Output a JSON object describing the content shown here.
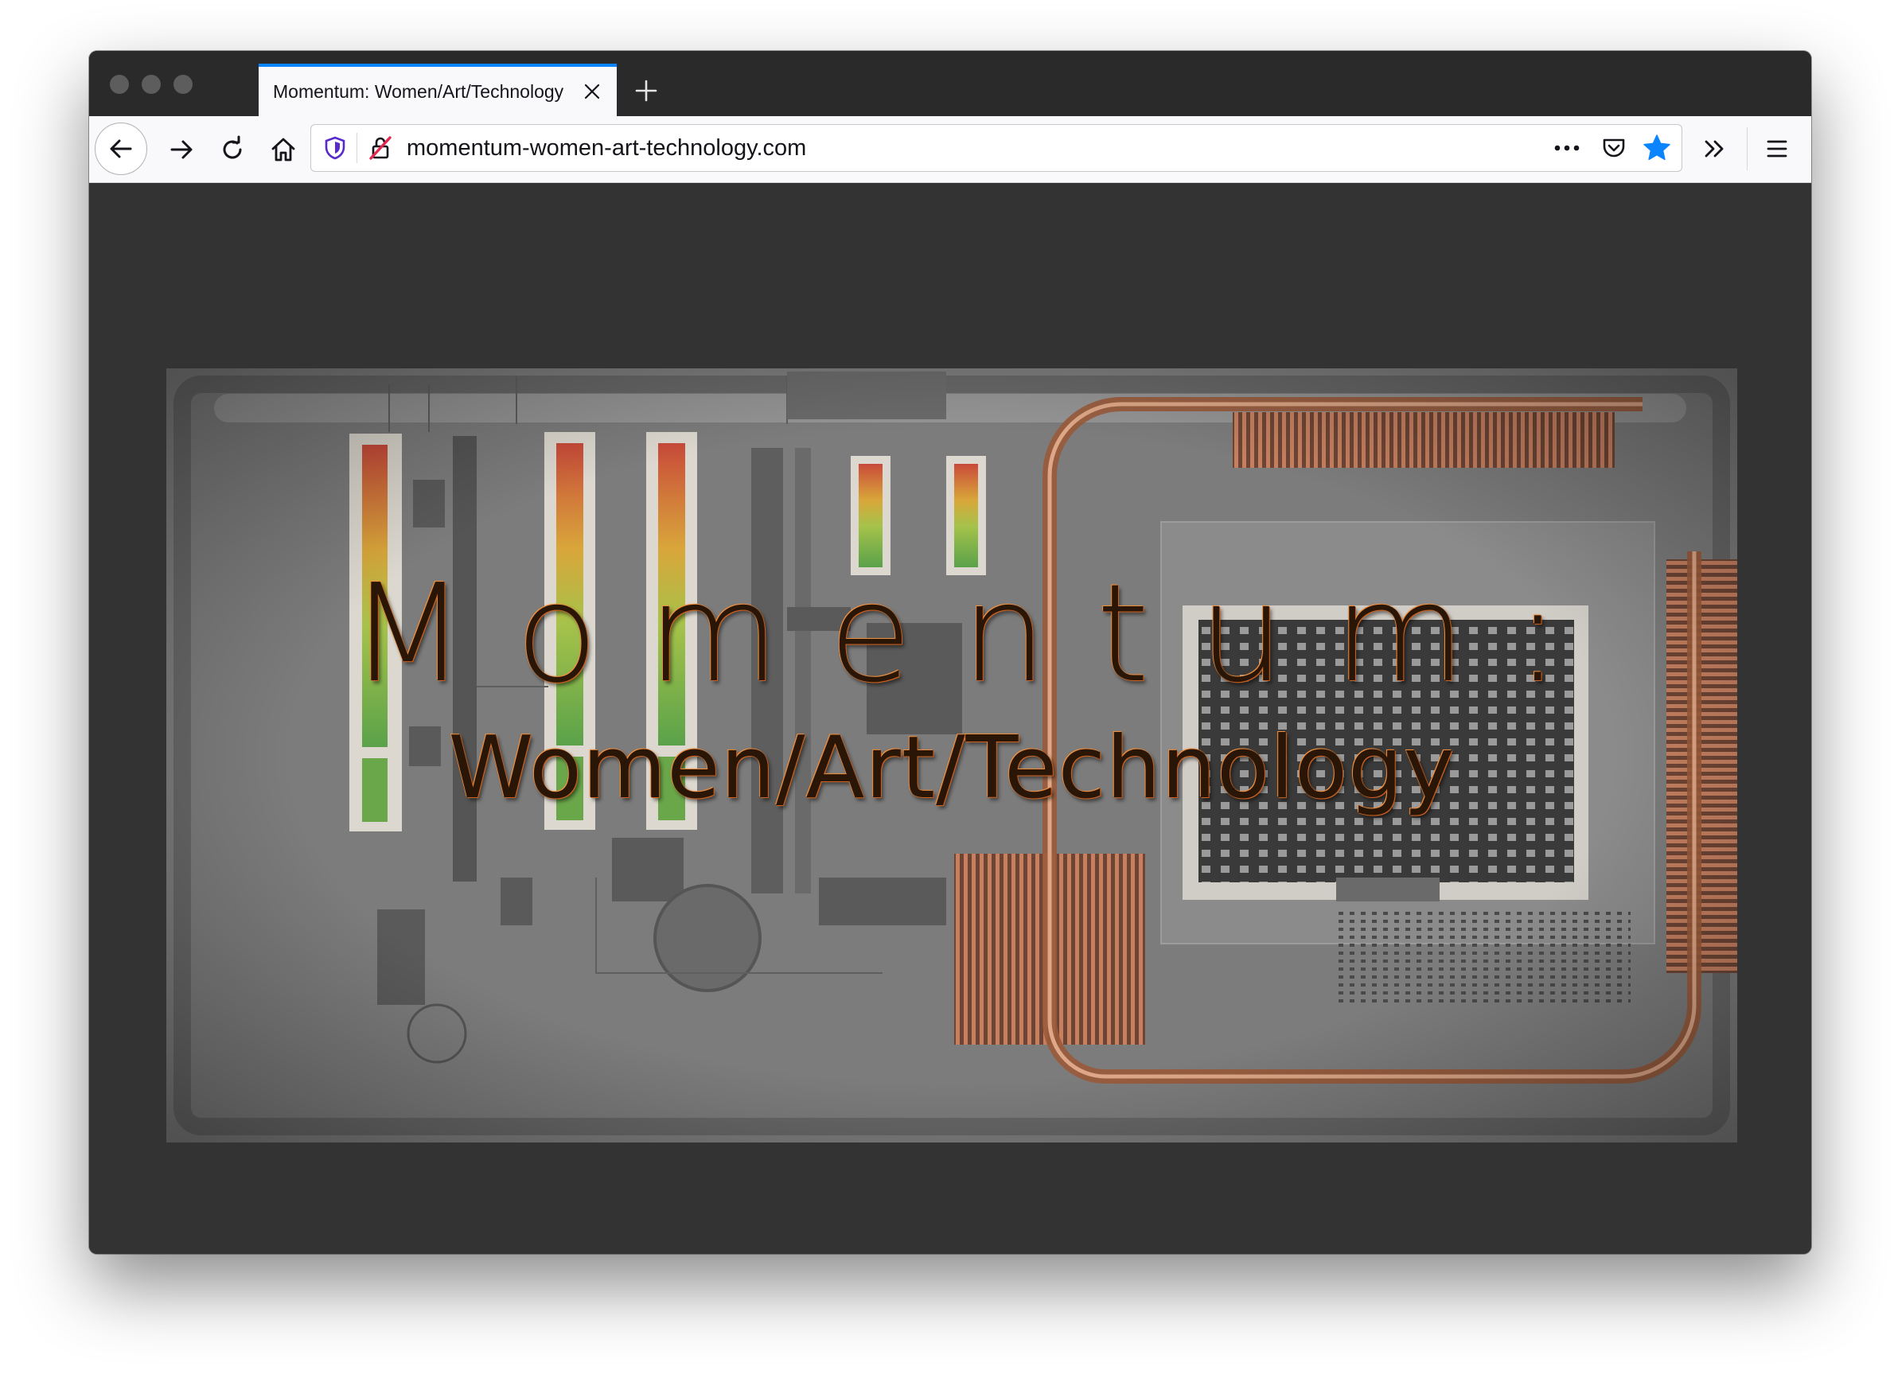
{
  "browser": {
    "tab": {
      "title": "Momentum: Women/Art/Technology",
      "close_icon": "close-icon"
    },
    "new_tab_icon": "plus-icon",
    "nav": {
      "back_icon": "arrow-left-icon",
      "forward_icon": "arrow-right-icon",
      "reload_icon": "reload-icon",
      "home_icon": "home-icon"
    },
    "urlbar": {
      "url": "momentum-women-art-technology.com",
      "tracking_icon": "shield-icon",
      "security_icon": "insecure-lock-icon",
      "page_actions_icon": "more-dots-icon",
      "pocket_icon": "pocket-icon",
      "bookmark_icon": "star-icon"
    },
    "overflow_icon": "double-chevron-icon",
    "menu_icon": "hamburger-menu-icon"
  },
  "page": {
    "hero": {
      "title": "Momentum:",
      "subtitle": "Women/Art/Technology",
      "background": "circuit-board-image"
    }
  },
  "colors": {
    "accent": "#0a84ff",
    "bookmark_star": "#0a84ff",
    "tracking_shield": "#592acb",
    "page_background": "#333333",
    "title_glow": "#e0762a"
  }
}
